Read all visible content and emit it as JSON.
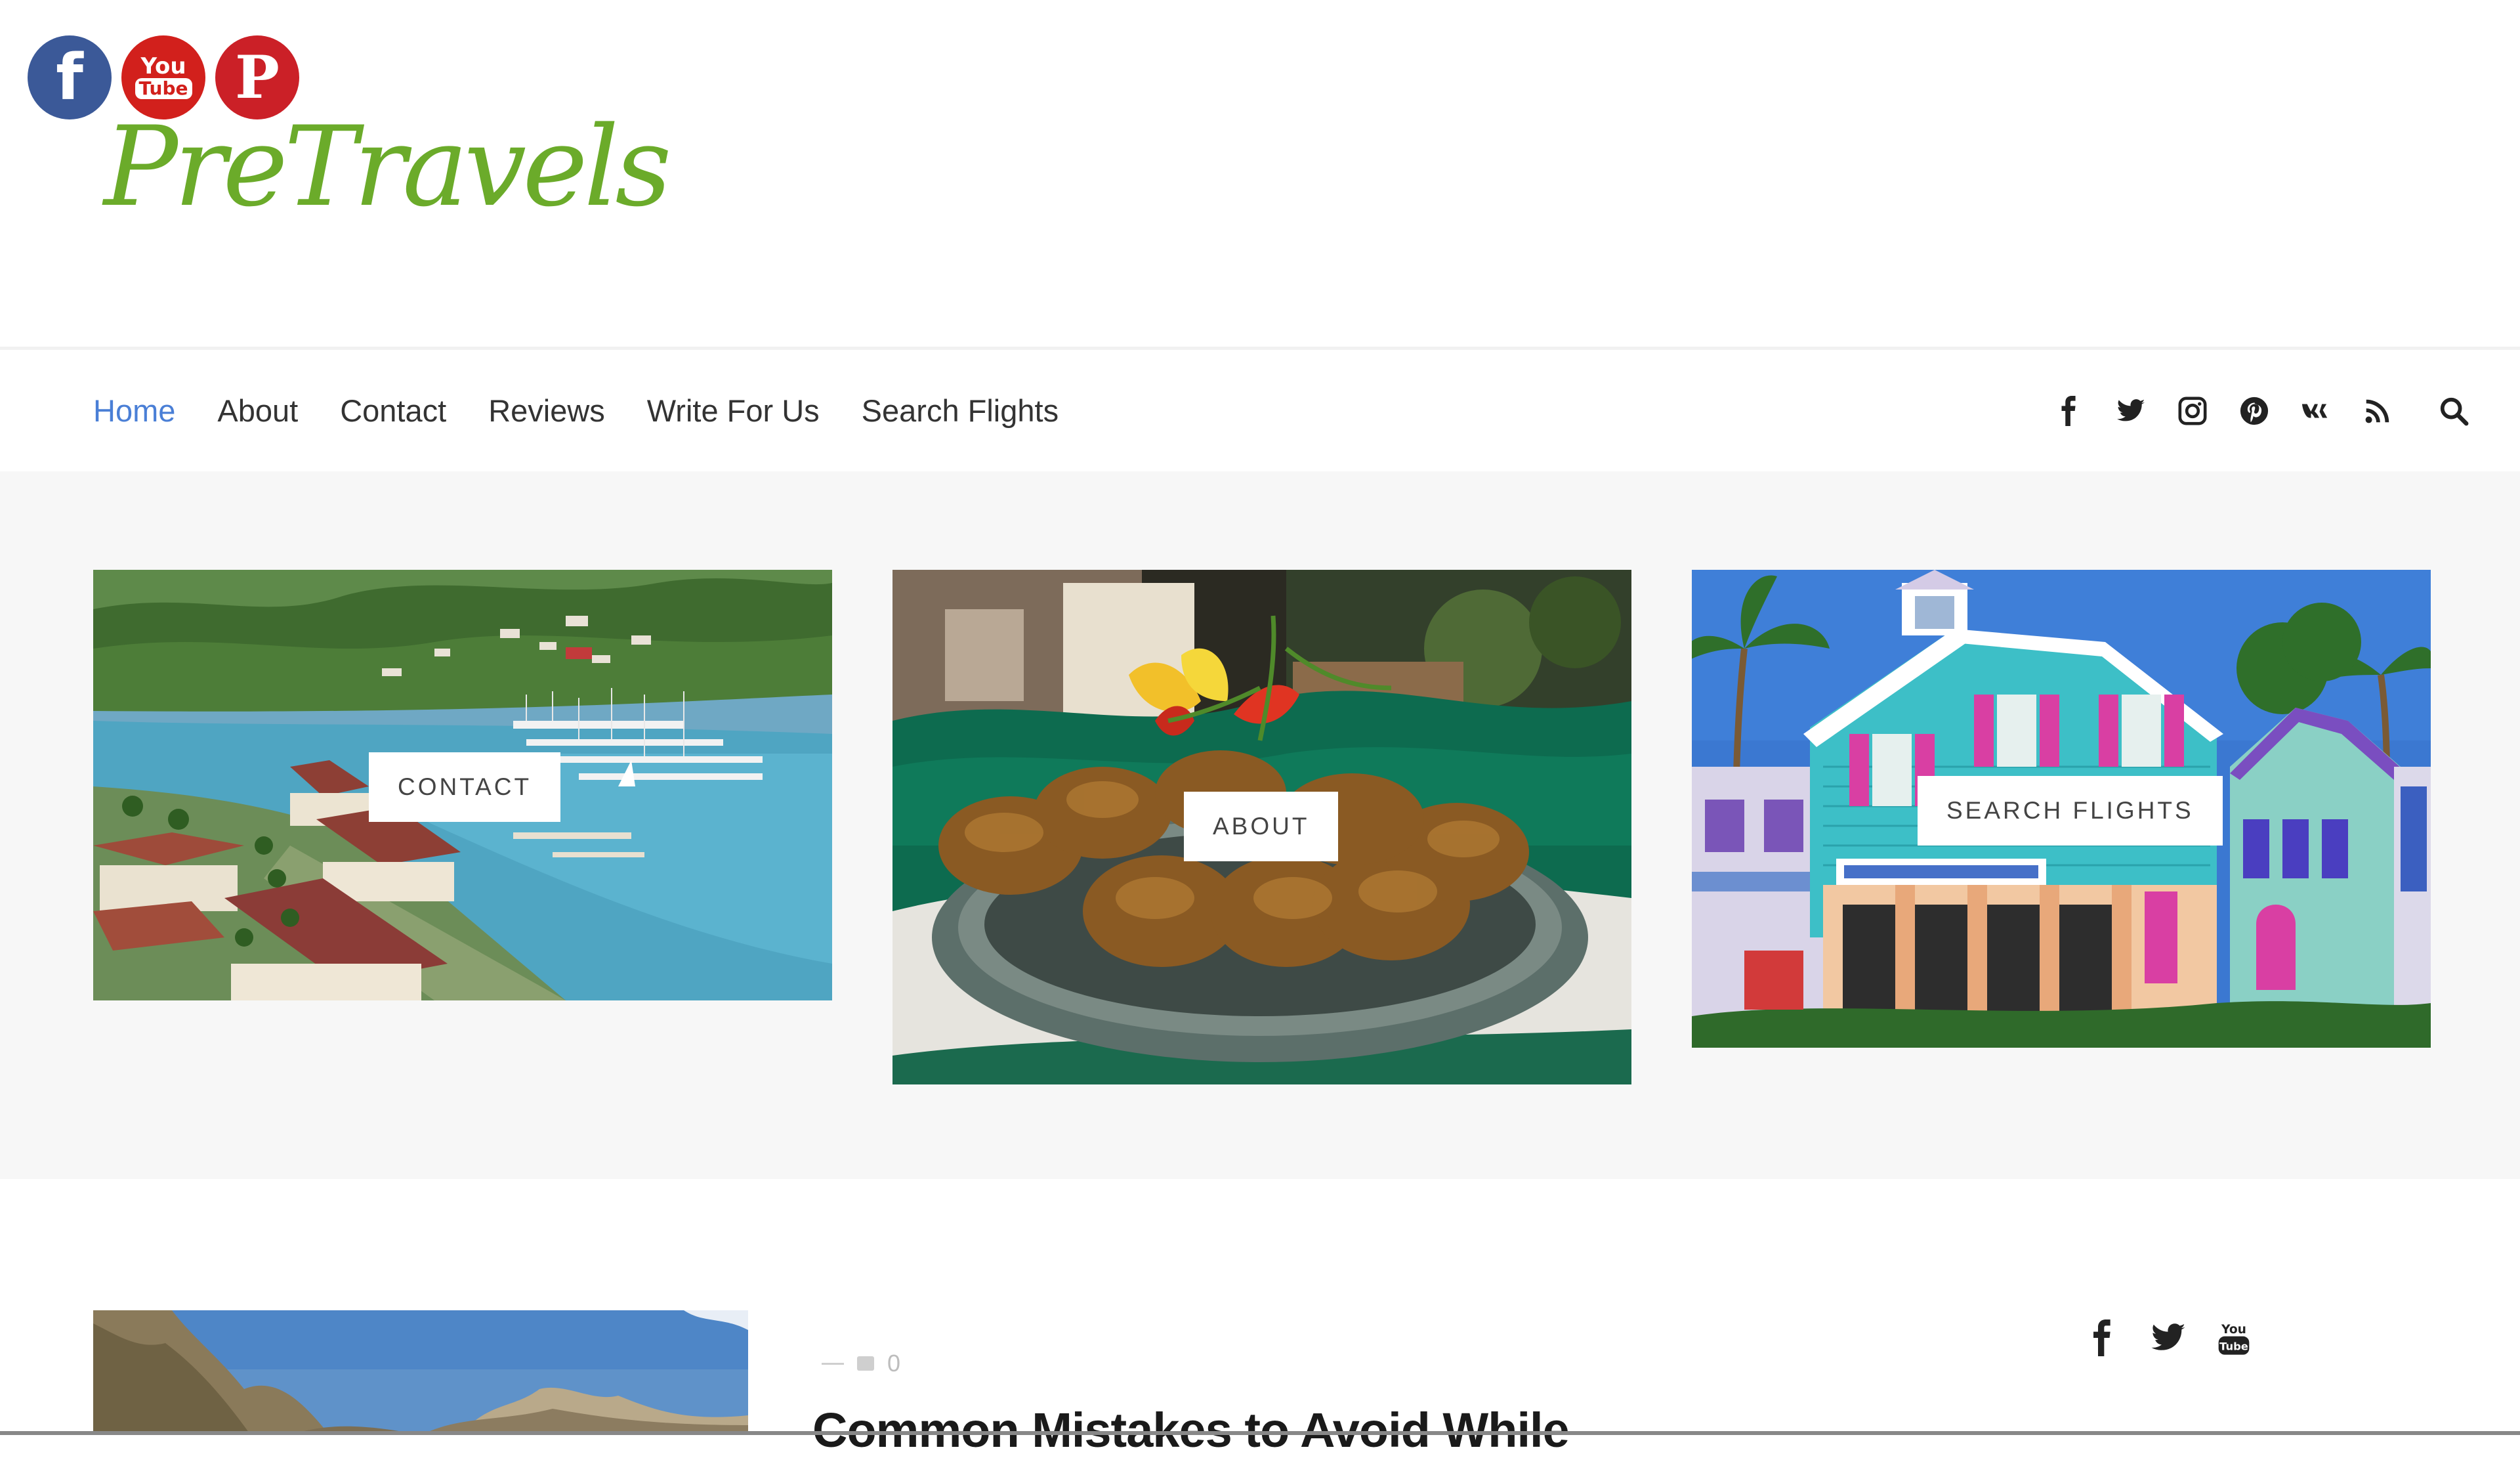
{
  "header": {
    "logo_text": "PreTravels",
    "social_circles": [
      {
        "icon": "facebook-icon",
        "glyph": "f",
        "color": "#3b5998"
      },
      {
        "icon": "youtube-icon",
        "glyph_top": "You",
        "glyph_bottom": "Tube",
        "color": "#d2201c"
      },
      {
        "icon": "pinterest-icon",
        "glyph": "P",
        "color": "#cb2027"
      }
    ]
  },
  "nav": {
    "items": [
      {
        "label": "Home",
        "active": true
      },
      {
        "label": "About",
        "active": false
      },
      {
        "label": "Contact",
        "active": false
      },
      {
        "label": "Reviews",
        "active": false
      },
      {
        "label": "Write For Us",
        "active": false
      },
      {
        "label": "Search Flights",
        "active": false
      }
    ],
    "icons": [
      "facebook-icon",
      "twitter-icon",
      "instagram-icon",
      "pinterest-icon",
      "vk-icon",
      "rss-icon",
      "search-icon"
    ],
    "active_color": "#4a7fd6"
  },
  "featured": {
    "cards": [
      {
        "label": "CONTACT",
        "image": "harbor-aerial-image"
      },
      {
        "label": "ABOUT",
        "image": "fritters-plate-image"
      },
      {
        "label": "SEARCH FLIGHTS",
        "image": "colorful-shops-image"
      }
    ]
  },
  "post": {
    "meta_comments": "0",
    "title": "Common Mistakes to Avoid While"
  },
  "sidebar": {
    "icons": [
      "facebook-icon",
      "twitter-icon",
      "youtube-icon"
    ]
  }
}
